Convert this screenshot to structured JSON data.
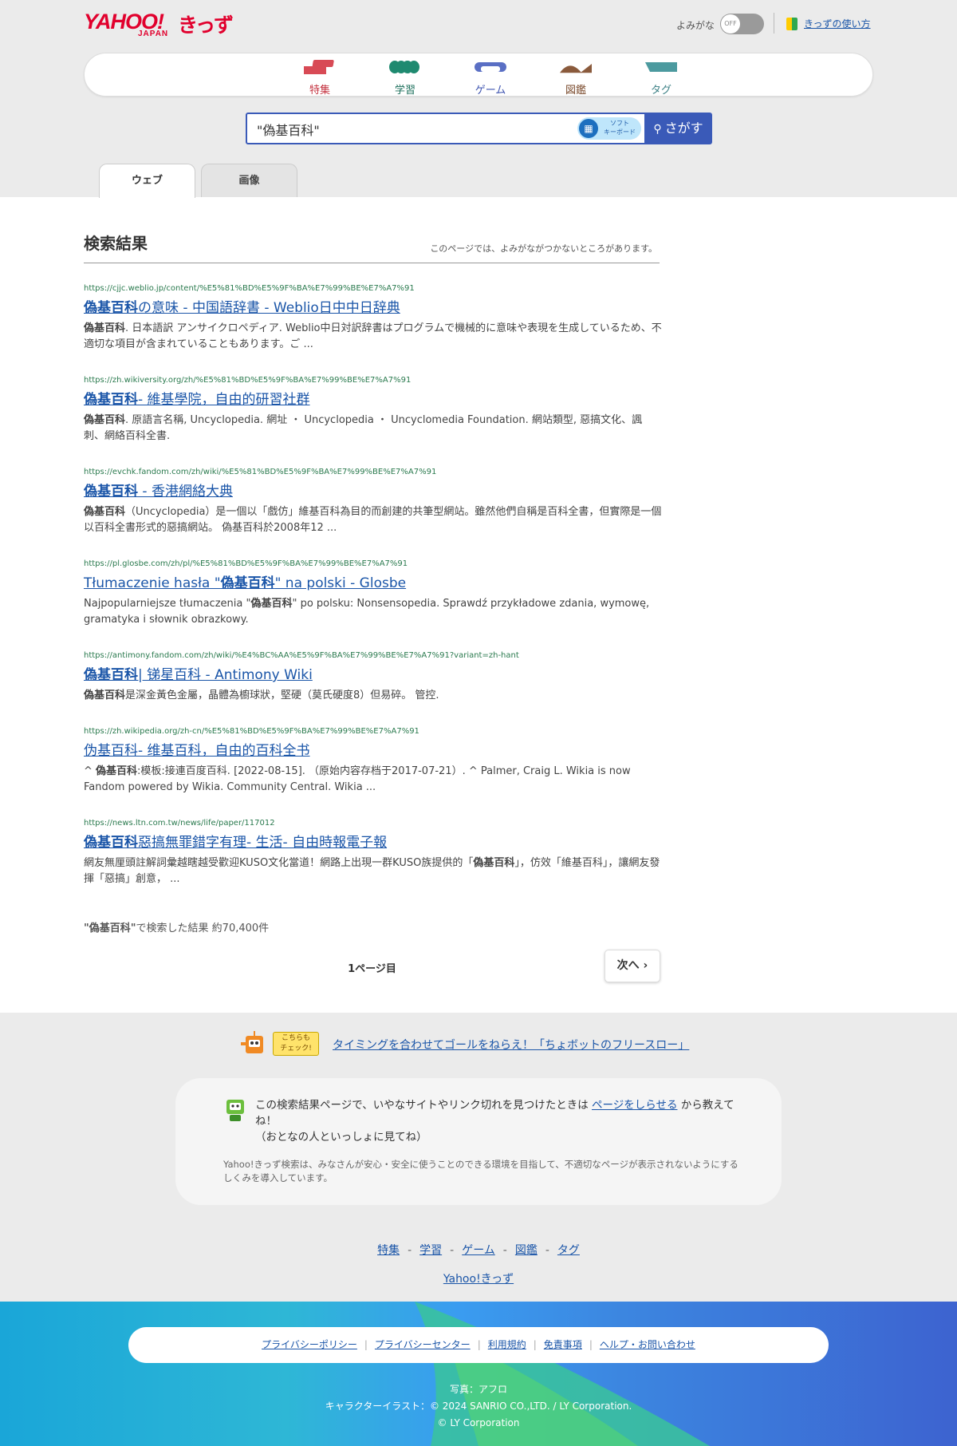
{
  "header": {
    "logo_main": "YAHOO!",
    "logo_sub": "JAPAN",
    "logo_kids": "きっず",
    "yomigana_label": "よみがな",
    "yomigana_state": "OFF",
    "howto_label": "きっずの使い方"
  },
  "nav": {
    "items": [
      {
        "label": "特集",
        "color": "#d84a55"
      },
      {
        "label": "学習",
        "color": "#1f8a70"
      },
      {
        "label": "ゲーム",
        "color": "#5a6fc4"
      },
      {
        "label": "図鑑",
        "color": "#8a5a3c"
      },
      {
        "label": "タグ",
        "color": "#4c9a9f"
      }
    ]
  },
  "search": {
    "query": "\"偽基百科\"",
    "soft_keyboard_label_1": "ソフト",
    "soft_keyboard_label_2": "キーボード",
    "button_label": "さがす"
  },
  "tabs": {
    "web": "ウェブ",
    "image": "画像"
  },
  "results": {
    "heading": "検索結果",
    "note": "このページでは、よみがながつかないところがあります。",
    "items": [
      {
        "url": "https://cjjc.weblio.jp/content/%E5%81%BD%E5%9F%BA%E7%99%BE%E7%A7%91",
        "title_bold": "偽基百科",
        "title_rest": "の意味 - 中国語辞書 - Weblio日中中日辞典",
        "snippet_bold": "偽基百科",
        "snippet_rest": ". 日本語訳 アンサイクロペディア. Weblio中日対訳辞書はプログラムで機械的に意味や表現を生成しているため、不適切な項目が含まれていることもあります。ご ..."
      },
      {
        "url": "https://zh.wikiversity.org/zh/%E5%81%BD%E5%9F%BA%E7%99%BE%E7%A7%91",
        "title_bold": "偽基百科",
        "title_rest": "- 維基學院，自由的研習社群",
        "snippet_bold": "偽基百科",
        "snippet_rest": ". 原語言名稱, Uncyclopedia. 網址 ・ Uncyclopedia ・ Uncyclomedia Foundation. 網站類型, 惡搞文化、諷刺、網絡百科全書."
      },
      {
        "url": "https://evchk.fandom.com/zh/wiki/%E5%81%BD%E5%9F%BA%E7%99%BE%E7%A7%91",
        "title_bold": "偽基百科",
        "title_rest": " - 香港網絡大典",
        "snippet_bold": "偽基百科",
        "snippet_rest": "（Uncyclopedia）是一個以「戲仿」維基百科為目的而創建的共筆型網站。雖然他們自稱是百科全書，但實際是一個以百科全書形式的惡搞網站。 偽基百科於2008年12 ..."
      },
      {
        "url": "https://pl.glosbe.com/zh/pl/%E5%81%BD%E5%9F%BA%E7%99%BE%E7%A7%91",
        "title_pre": "Tłumaczenie hasła \"",
        "title_bold": "偽基百科",
        "title_rest": "\" na polski - Glosbe",
        "snippet_pre": "Najpopularniejsze tłumaczenia \"",
        "snippet_bold": "偽基百科",
        "snippet_rest": "\" po polsku: Nonsensopedia. Sprawdź przykładowe zdania, wymowę, gramatyka i słownik obrazkowy."
      },
      {
        "url": "https://antimony.fandom.com/zh/wiki/%E4%BC%AA%E5%9F%BA%E7%99%BE%E7%A7%91?variant=zh-hant",
        "title_bold": "偽基百科",
        "title_rest": "| 锑星百科 - Antimony Wiki",
        "snippet_bold": "偽基百科",
        "snippet_rest": "是深金黃色金屬，晶體為櫥球狀，堅硬（莫氏硬度8）但易碎。 管控."
      },
      {
        "url": "https://zh.wikipedia.org/zh-cn/%E5%81%BD%E5%9F%BA%E7%99%BE%E7%A7%91",
        "title_bold": "",
        "title_rest": "伪基百科- 维基百科，自由的百科全书",
        "snippet_pre": "^ ",
        "snippet_bold": "偽基百科",
        "snippet_rest": ":模板:接連百度百科. [2022-08-15]. （原始内容存档于2017-07-21）. ^ Palmer, Craig L. Wikia is now Fandom powered by Wikia. Community Central. Wikia ..."
      },
      {
        "url": "https://news.ltn.com.tw/news/life/paper/117012",
        "title_bold": "偽基百科",
        "title_rest": "惡搞無罪錯字有理- 生活- 自由時報電子報",
        "snippet_pre": "網友無厘頭註解詞彙越瞎越受歡迎KUSO文化當道！網路上出現一群KUSO族提供的「",
        "snippet_bold": "偽基百科",
        "snippet_rest": "」，仿效「維基百科」，讓網友發揮「惡搞」創意， ..."
      }
    ],
    "summary_bold": "\"偽基百科\"",
    "summary_rest": "で検索した結果 約70,400件",
    "page_label": "1ページ目",
    "next_label": "次へ"
  },
  "promo": {
    "badge_1": "こちらも",
    "badge_2": "チェック!",
    "link": "タイミングを合わせてゴールをねらえ！「ちょボットのフリースロー」"
  },
  "report": {
    "text_pre": "この検索結果ページで、いやなサイトやリンク切れを見つけたときは ",
    "link": "ページをしらせる",
    "text_post": " から教えてね！",
    "text_line2": "（おとなの人といっしょに見てね）",
    "note": "Yahoo!きっず検索は、みなさんが安心・安全に使うことのできる環境を目指して、不適切なページが表示されないようにするしくみを導入しています。"
  },
  "footer_nav": {
    "items": [
      "特集",
      "学習",
      "ゲーム",
      "図鑑",
      "タグ"
    ],
    "home": "Yahoo!きっず"
  },
  "footer": {
    "links": [
      "プライバシーポリシー",
      "プライバシーセンター",
      "利用規約",
      "免責事項",
      "ヘルプ・お問い合わせ"
    ],
    "credit_1": "写真：アフロ",
    "credit_2": "キャラクターイラスト：© 2024 SANRIO CO.,LTD. / LY Corporation.",
    "credit_3": "© LY Corporation"
  }
}
